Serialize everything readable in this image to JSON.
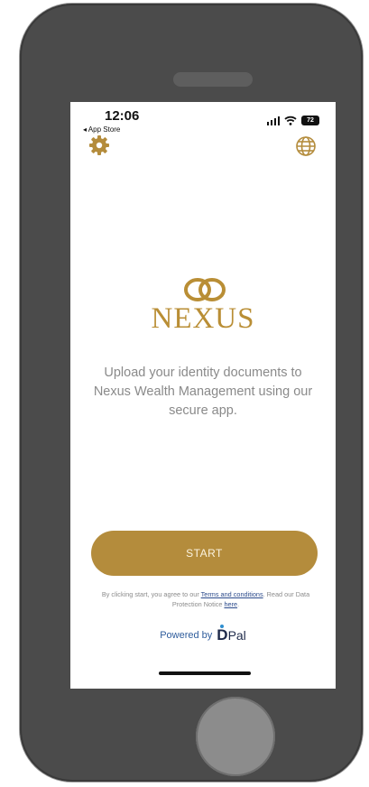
{
  "status_bar": {
    "time": "12:06",
    "back_label": "◂ App Store",
    "battery": "72"
  },
  "top_icons": {
    "settings_icon": "gear-icon",
    "language_icon": "globe-icon"
  },
  "brand": {
    "name": "NEXUS",
    "color": "#b98e35"
  },
  "tagline": "Upload your identity documents to Nexus Wealth Management using our secure app.",
  "start_button": {
    "label": "START",
    "color": "#b48c3c"
  },
  "terms": {
    "prefix": "By clicking start, you agree to our ",
    "terms_link": "Terms and conditions",
    "middle": ". Read our Data Protection Notice ",
    "here_link": "here",
    "suffix": "."
  },
  "powered": {
    "label": "Powered by",
    "logo_d": "D",
    "logo_pal": "Pal"
  }
}
